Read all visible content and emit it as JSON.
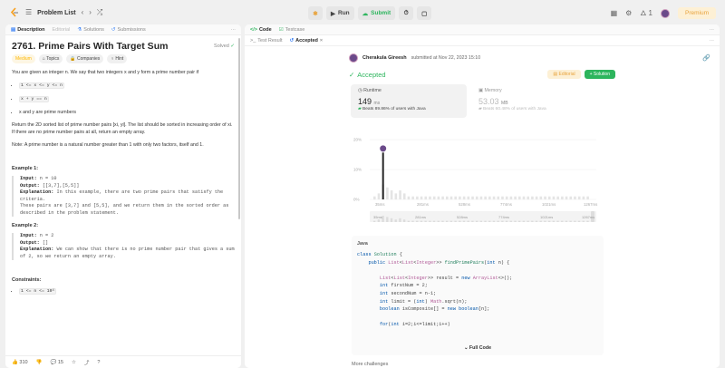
{
  "topbar": {
    "title": "Problem List",
    "run": "Run",
    "submit": "Submit",
    "premium": "Premium",
    "streak": "1"
  },
  "left_tabs": [
    {
      "label": "Description"
    },
    {
      "label": "Editorial"
    },
    {
      "label": "Solutions"
    },
    {
      "label": "Submissions"
    }
  ],
  "problem": {
    "title": "2761. Prime Pairs With Target Sum",
    "solved": "Solved",
    "difficulty": "Medium",
    "topics": "Topics",
    "companies": "Companies",
    "hint": "Hint",
    "p1": "You are given an integer n. We say that two integers x and y form a prime number pair if",
    "b1": "1 <= x <= y <= n",
    "b2": "x + y == n",
    "b3": "x and y are prime numbers",
    "p2": "Return the 2D sorted list of prime number pairs [xi, yi]. The list should be sorted in increasing order of xi. If there are no prime number pairs at all, return an empty array.",
    "note": "Note: A prime number is a natural number greater than 1 with only two factors, itself and 1.",
    "ex1h": "Example 1:",
    "ex1_input": "n = 10",
    "ex1_output": "[[3,7],[5,5]]",
    "ex1_expl": "In this example, there are two prime pairs that satisfy the criteria.\nThese pairs are [3,7] and [5,5], and we return them in the sorted order as described in the problem statement.",
    "ex2h": "Example 2:",
    "ex2_input": "n = 2",
    "ex2_output": "[]",
    "ex2_expl": "We can show that there is no prime number pair that gives a sum of 2, so we return an empty array.",
    "constraints_h": "Constraints:",
    "c1": "1 <= n <= 10⁶"
  },
  "footer": {
    "likes": "310",
    "comments": "15"
  },
  "right_tabs": {
    "code": "Code",
    "testcase": "Testcase",
    "test_result": "Test Result",
    "accepted": "Accepted"
  },
  "submission": {
    "user": "Cherakula Gireesh",
    "submitted": "submitted at Nov 22, 2023 15:10",
    "status": "Accepted",
    "editorial": "Editorial",
    "solution": "+ Solution",
    "runtime_label": "Runtime",
    "runtime_value": "149",
    "runtime_unit": "ms",
    "runtime_beats": "Beats 89.86% of users with Java",
    "memory_label": "Memory",
    "memory_value": "53.03",
    "memory_unit": "MB",
    "memory_beats": "Beats 60.48% of users with Java"
  },
  "chart_data": {
    "type": "bar",
    "title": "",
    "y_ticks": [
      "20%",
      "10%",
      "0%"
    ],
    "ylim": [
      0,
      20
    ],
    "x_labels": [
      "35ms",
      "281ms",
      "528ms",
      "774ms",
      "1021ms",
      "1267ms"
    ],
    "mini_labels": [
      "35ms",
      "281ms",
      "528ms",
      "774ms",
      "1021ms",
      "1267ms"
    ],
    "values": [
      1,
      2,
      5,
      4,
      3,
      2,
      3,
      2,
      1,
      1,
      1,
      1,
      1,
      1,
      1,
      1,
      1,
      1,
      1,
      1,
      1,
      1,
      1,
      1,
      1,
      1,
      1,
      1,
      1,
      1,
      1,
      1,
      1,
      1,
      1,
      1,
      1,
      1,
      1,
      1,
      1,
      1,
      1,
      1,
      1,
      1,
      1,
      1,
      1,
      1,
      1
    ],
    "highlight_index": 2,
    "highlight_value": 17
  },
  "code": {
    "lang": "Java",
    "full_code": "Full Code"
  },
  "more": "More challenges"
}
